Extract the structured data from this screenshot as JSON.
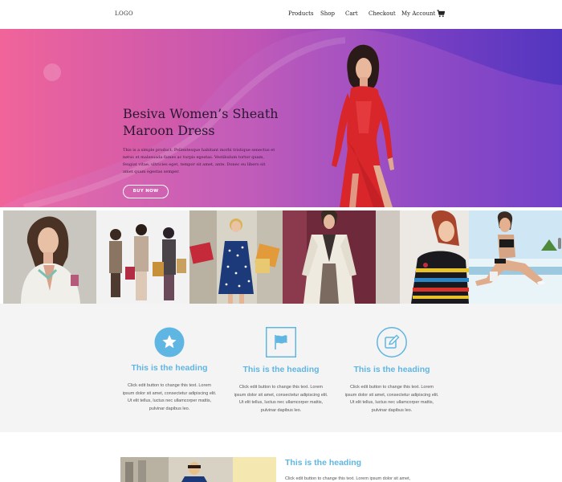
{
  "header": {
    "logo": "LOGO",
    "nav": [
      "Products",
      "Shop",
      "Cart",
      "Checkout",
      "My Account"
    ],
    "cart_icon": "shopping-cart-icon"
  },
  "hero": {
    "title": "Besiva Women’s Sheath Maroon Dress",
    "description": "This is a simple product. Pellentesque habitant morbi tristique senectus et netus et malesuada fames ac turpis egestas. Vestibulum tortor quam, feugiat vitae, ultricies eget, tempor sit amet, ante. Donec eu libero sit amet quam egestas semper.",
    "button": "BUY NOW",
    "colors": {
      "gradient_start": "#f0649a",
      "gradient_end": "#5236c0"
    }
  },
  "gallery": {
    "photos": [
      "woman-blazer-photo",
      "shopping-friends-photo",
      "polka-dress-photo",
      "trench-coat-photo",
      "stripe-top-photo",
      "beach-sitting-photo"
    ]
  },
  "features": [
    {
      "icon": "star-icon",
      "heading": "This is the heading",
      "text": "Click edit button to change this text. Lorem ipsum dolor sit amet, consectetur adipiscing elit. Ut elit tellus, luctus nec ullamcorper mattis, pulvinar dapibus leo."
    },
    {
      "icon": "flag-icon",
      "heading": "This is the heading",
      "text": "Click edit button to change this text. Lorem ipsum dolor sit amet, consectetur adipiscing elit. Ut elit tellus, luctus nec ullamcorper mattis, pulvinar dapibus leo."
    },
    {
      "icon": "edit-icon",
      "heading": "This is the heading",
      "text": "Click edit button to change this text. Lorem ipsum dolor sit amet, consectetur adipiscing elit. Ut elit tellus, luctus nec ullamcorper mattis, pulvinar dapibus leo."
    }
  ],
  "bottom": {
    "heading": "This is the heading",
    "text": "Click edit button to change this text. Lorem ipsum dolor sit amet,"
  },
  "accent_color": "#5fb6e2"
}
